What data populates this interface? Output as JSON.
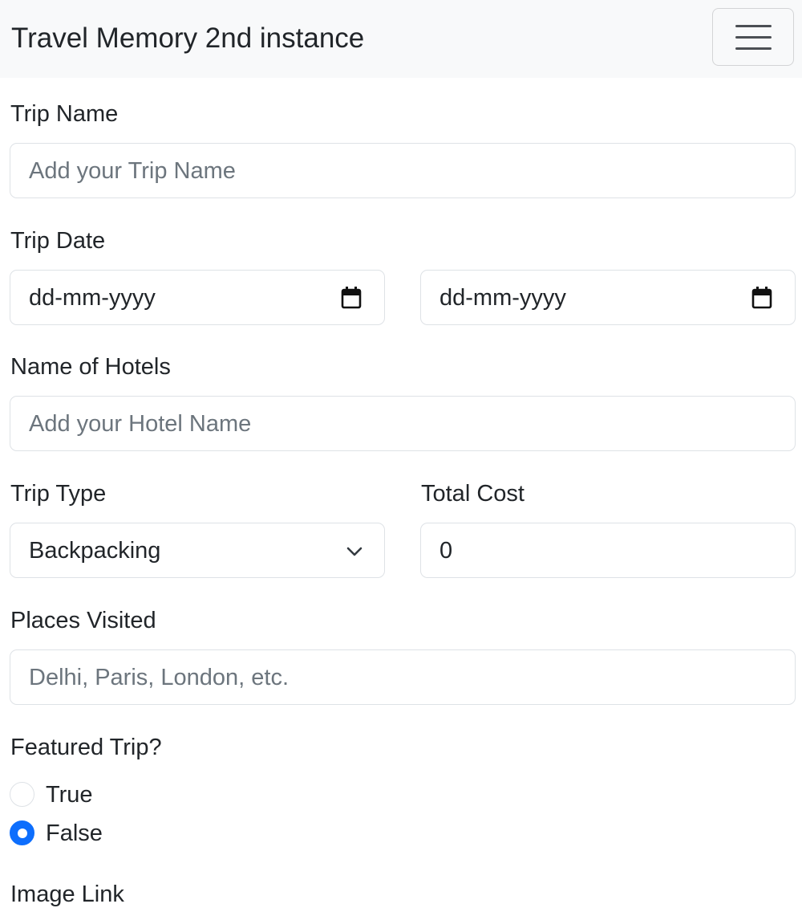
{
  "navbar": {
    "brand": "Travel Memory 2nd instance",
    "toggler_icon": "hamburger-menu-icon"
  },
  "form": {
    "trip_name": {
      "label": "Trip Name",
      "placeholder": "Add your Trip Name"
    },
    "trip_date": {
      "label": "Trip Date",
      "start_placeholder": "dd-mm-yyyy",
      "end_placeholder": "dd-mm-yyyy",
      "icon": "calendar-icon"
    },
    "hotels": {
      "label": "Name of Hotels",
      "placeholder": "Add your Hotel Name"
    },
    "trip_type": {
      "label": "Trip Type",
      "selected": "Backpacking",
      "icon": "chevron-down-icon"
    },
    "total_cost": {
      "label": "Total Cost",
      "value": "0"
    },
    "places": {
      "label": "Places Visited",
      "placeholder": "Delhi, Paris, London, etc."
    },
    "featured": {
      "label": "Featured Trip?",
      "options": [
        {
          "label": "True",
          "checked": false
        },
        {
          "label": "False",
          "checked": true
        }
      ]
    },
    "image_link": {
      "label": "Image Link"
    }
  },
  "colors": {
    "accent": "#0d6efd",
    "navbar_bg": "#f8f9fa",
    "border": "#dee2e6",
    "placeholder": "#6c757d",
    "text": "#212529"
  }
}
